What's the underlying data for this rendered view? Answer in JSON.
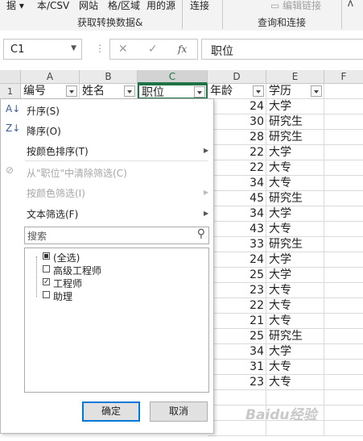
{
  "ribbon": {
    "items": [
      "据 ▾",
      "本/CSV",
      "网站",
      "格/区域",
      "用的源",
      "连接"
    ],
    "group_left": "获取转换数据&",
    "edit_links": "编辑链接",
    "group_right": "查询和连接"
  },
  "formula_bar": {
    "name_box": "C1",
    "cancel_icon": "✕",
    "enter_icon": "✓",
    "fx": "fx",
    "value": "职位"
  },
  "columns": [
    "A",
    "B",
    "C",
    "D",
    "E",
    "F"
  ],
  "selected_column": "C",
  "header_row": {
    "row_number": "1",
    "A": "编号",
    "B": "姓名",
    "C": "职位",
    "D": "年龄",
    "E": "学历"
  },
  "rows": [
    {
      "age": "24",
      "edu": "大学"
    },
    {
      "age": "30",
      "edu": "研究生"
    },
    {
      "age": "28",
      "edu": "研究生"
    },
    {
      "age": "22",
      "edu": "大学"
    },
    {
      "age": "22",
      "edu": "大专"
    },
    {
      "age": "34",
      "edu": "大专"
    },
    {
      "age": "45",
      "edu": "研究生"
    },
    {
      "age": "34",
      "edu": "大学"
    },
    {
      "age": "43",
      "edu": "大专"
    },
    {
      "age": "33",
      "edu": "研究生"
    },
    {
      "age": "24",
      "edu": "大学"
    },
    {
      "age": "25",
      "edu": "大学"
    },
    {
      "age": "23",
      "edu": "大专"
    },
    {
      "age": "22",
      "edu": "大专"
    },
    {
      "age": "21",
      "edu": "大专"
    },
    {
      "age": "25",
      "edu": "研究生"
    },
    {
      "age": "34",
      "edu": "大学"
    },
    {
      "age": "31",
      "edu": "大专"
    },
    {
      "age": "23",
      "edu": "大专"
    }
  ],
  "filter_menu": {
    "sort_asc": "升序(S)",
    "sort_desc": "降序(O)",
    "sort_by_color": "按颜色排序(T)",
    "clear_filter": "从\"职位\"中清除筛选(C)",
    "filter_by_color": "按颜色筛选(I)",
    "text_filter": "文本筛选(F)",
    "search_placeholder": "搜索",
    "checklist": [
      {
        "label": "(全选)",
        "state": "partial"
      },
      {
        "label": "高级工程师",
        "state": "unchecked"
      },
      {
        "label": "工程师",
        "state": "checked"
      },
      {
        "label": "助理",
        "state": "unchecked"
      }
    ],
    "ok": "确定",
    "cancel": "取消"
  },
  "watermark": "Baidu经验"
}
